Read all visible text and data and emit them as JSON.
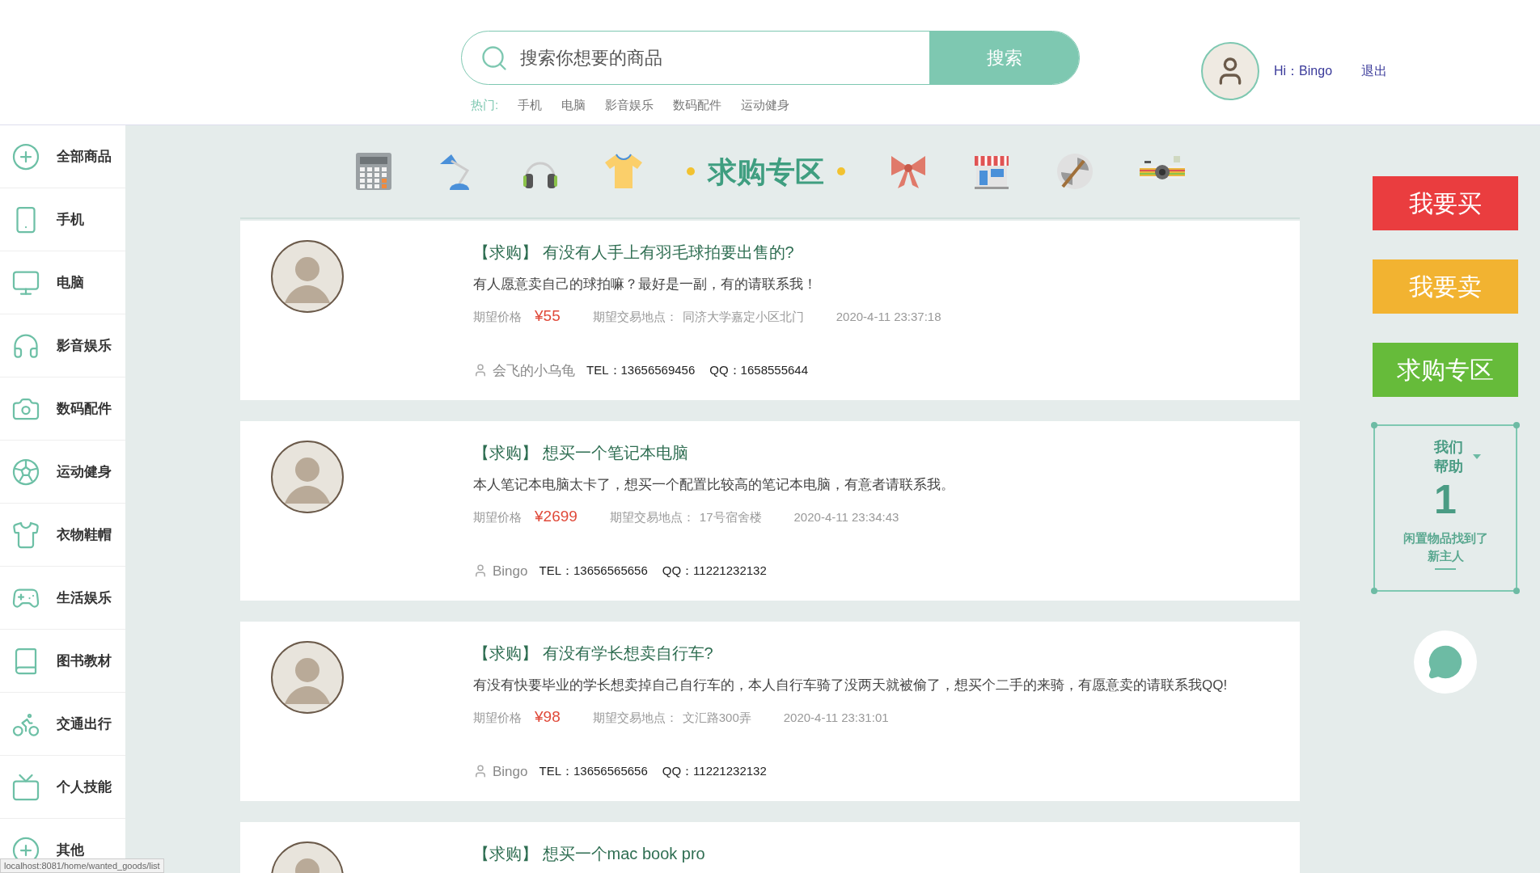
{
  "header": {
    "search": {
      "placeholder": "搜索你想要的商品",
      "button": "搜索"
    },
    "hot_label": "热门:",
    "hot_tags": [
      "手机",
      "电脑",
      "影音娱乐",
      "数码配件",
      "运动健身"
    ],
    "greeting": "Hi：Bingo",
    "logout": "退出"
  },
  "sidebar": {
    "items": [
      {
        "label": "全部商品"
      },
      {
        "label": "手机"
      },
      {
        "label": "电脑"
      },
      {
        "label": "影音娱乐"
      },
      {
        "label": "数码配件"
      },
      {
        "label": "运动健身"
      },
      {
        "label": "衣物鞋帽"
      },
      {
        "label": "生活娱乐"
      },
      {
        "label": "图书教材"
      },
      {
        "label": "交通出行"
      },
      {
        "label": "个人技能"
      },
      {
        "label": "其他"
      }
    ]
  },
  "banner": {
    "title": "求购专区"
  },
  "posts": [
    {
      "tag": "【求购】",
      "title": "有没有人手上有羽毛球拍要出售的?",
      "description": "有人愿意卖自己的球拍嘛？最好是一副，有的请联系我！",
      "price_label": "期望价格",
      "price": "¥55",
      "location_label": "期望交易地点：",
      "location": "同济大学嘉定小区北门",
      "time": "2020-4-11 23:37:18",
      "user": "会飞的小乌龟",
      "tel_label": "TEL：",
      "tel": "13656569456",
      "qq_label": "QQ：",
      "qq": "1658555644"
    },
    {
      "tag": "【求购】",
      "title": "想买一个笔记本电脑",
      "description": "本人笔记本电脑太卡了，想买一个配置比较高的笔记本电脑，有意者请联系我。",
      "price_label": "期望价格",
      "price": "¥2699",
      "location_label": "期望交易地点：",
      "location": "17号宿舍楼",
      "time": "2020-4-11 23:34:43",
      "user": "Bingo",
      "tel_label": "TEL：",
      "tel": "13656565656",
      "qq_label": "QQ：",
      "qq": "11221232132"
    },
    {
      "tag": "【求购】",
      "title": "有没有学长想卖自行车?",
      "description": "有没有快要毕业的学长想卖掉自己自行车的，本人自行车骑了没两天就被偷了，想买个二手的来骑，有愿意卖的请联系我QQ!",
      "price_label": "期望价格",
      "price": "¥98",
      "location_label": "期望交易地点：",
      "location": "文汇路300弄",
      "time": "2020-4-11 23:31:01",
      "user": "Bingo",
      "tel_label": "TEL：",
      "tel": "13656565656",
      "qq_label": "QQ：",
      "qq": "11221232132"
    },
    {
      "tag": "【求购】",
      "title": "想买一个mac book pro"
    }
  ],
  "side_buttons": [
    {
      "label": "我要买",
      "color": "#ea3d3f"
    },
    {
      "label": "我要卖",
      "color": "#f2b331"
    },
    {
      "label": "求购专区",
      "color": "#66bb3a"
    }
  ],
  "stats": {
    "heading": "我们帮助",
    "number": "1",
    "caption": "闲置物品找到了新主人"
  },
  "status_url": "localhost:8081/home/wanted_goods/list"
}
